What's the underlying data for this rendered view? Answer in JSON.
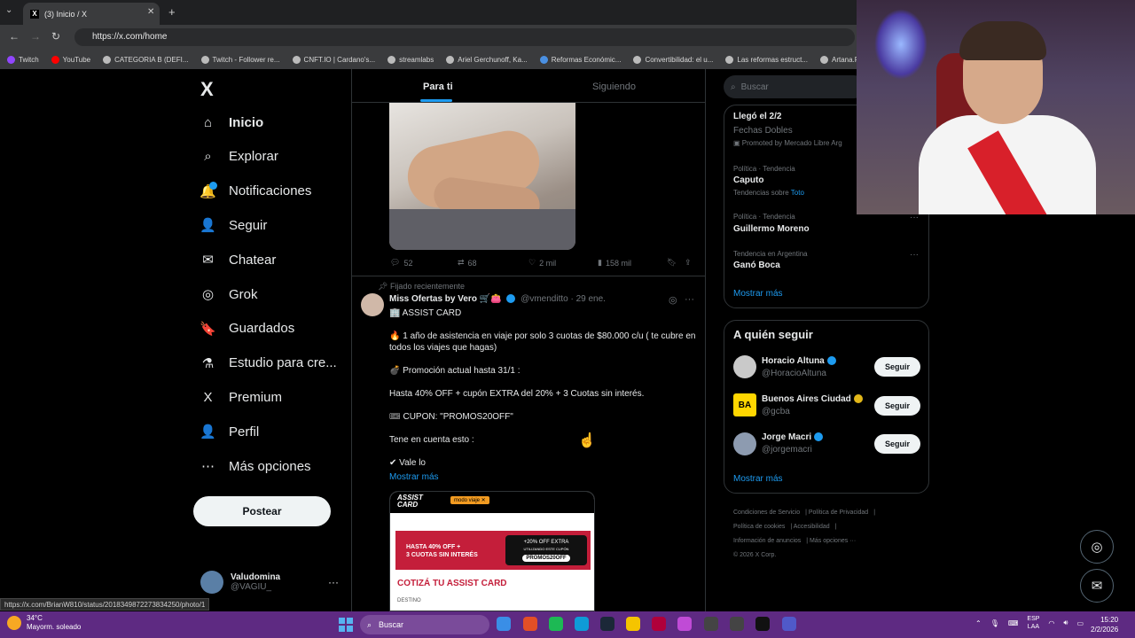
{
  "browser": {
    "tab_title": "(3) Inicio / X",
    "tab_close": "✕",
    "new_tab": "+",
    "tab_menu": "⌄",
    "url": "https://x.com/home",
    "bookmarks": [
      {
        "label": "Twitch",
        "color": "#9146ff"
      },
      {
        "label": "YouTube",
        "color": "#ff0000"
      },
      {
        "label": "CATEGORIA B (DEFI...",
        "color": "#bbbbbb"
      },
      {
        "label": "Twitch - Follower re...",
        "color": "#bbbbbb"
      },
      {
        "label": "CNFT.IO | Cardano's...",
        "color": "#bbbbbb"
      },
      {
        "label": "streamlabs",
        "color": "#bbbbbb"
      },
      {
        "label": "Ariel Gerchunoff, Ka...",
        "color": "#bbbbbb"
      },
      {
        "label": "Reformas Económic...",
        "color": "#4a90e2"
      },
      {
        "label": "Convertibilidad: el u...",
        "color": "#bbbbbb"
      },
      {
        "label": "Las reformas estruct...",
        "color": "#bbbbbb"
      },
      {
        "label": "Artana.PDF",
        "color": "#bbbbbb"
      }
    ]
  },
  "nav": {
    "logo": "X",
    "items": [
      {
        "label": "Inicio",
        "icon": "⌂"
      },
      {
        "label": "Explorar",
        "icon": "⌕"
      },
      {
        "label": "Notificaciones",
        "icon": "🔔"
      },
      {
        "label": "Seguir",
        "icon": "👤"
      },
      {
        "label": "Chatear",
        "icon": "✉"
      },
      {
        "label": "Grok",
        "icon": "◎"
      },
      {
        "label": "Guardados",
        "icon": "🔖"
      },
      {
        "label": "Estudio para cre...",
        "icon": "⚗"
      },
      {
        "label": "Premium",
        "icon": "X"
      },
      {
        "label": "Perfil",
        "icon": "👤"
      },
      {
        "label": "Más opciones",
        "icon": "⋯"
      }
    ],
    "post_label": "Postear",
    "account_name": "Valudomina",
    "account_handle": "@VAGIU_",
    "account_more": "···"
  },
  "feed": {
    "tab_for_you": "Para ti",
    "tab_following": "Siguiendo",
    "first_post_actions": {
      "replies": "52",
      "reposts": "68",
      "likes": "2 mil",
      "views": "158 mil"
    },
    "pinned_label": "Fijado recientemente",
    "tweet": {
      "name": "Miss Ofertas by Vero 🛒👛",
      "handle": "@vmenditto",
      "date": "· 29 ene.",
      "more": "···",
      "lines": [
        "🏢 ASSIST CARD",
        "🔥 1 año de asistencia en viaje por solo 3 cuotas de $80.000 c/u ( te cubre en todos los viajes que hagas)",
        "💣 Promoción actual hasta 31/1 :",
        "Hasta 40% OFF + cupón EXTRA del 20% + 3 Cuotas sin interés.",
        "🎟 CUPON: \"PROMOS20OFF\"",
        "Tene en cuenta esto :",
        "✔ Vale lo"
      ],
      "show_more": "Mostrar más"
    },
    "card": {
      "logo_line1": "ASSIST",
      "logo_line2": "CARD",
      "tag": "modo viaje ✕",
      "banner_line1": "HASTA 40% OFF +",
      "banner_line2": "3 CUOTAS SIN INTERÉS",
      "pill_line1": "+20% OFF EXTRA",
      "pill_line2": "UTILIZANDO ESTE CUPÓN",
      "pill_code": "PROMOS20OFF",
      "cta": "COTIZÁ TU ASSIST CARD",
      "dest": "DESTINO"
    }
  },
  "sidebar": {
    "search_placeholder": "Buscar",
    "trends": [
      {
        "meta": "",
        "title": "Llegó el 2/2",
        "sub": "Fechas Dobles",
        "extra": "Promoted by Mercado Libre Arg"
      },
      {
        "meta": "Política · Tendencia",
        "title": "Caputo",
        "sub": "Tendencias sobre",
        "extra": "Toto"
      },
      {
        "meta": "Política · Tendencia",
        "title": "Guillermo Moreno",
        "sub": "",
        "extra": ""
      },
      {
        "meta": "Tendencia en Argentina",
        "title": "Ganó Boca",
        "sub": "",
        "extra": ""
      }
    ],
    "trend_more": "···",
    "show_more": "Mostrar más",
    "who_to_follow_title": "A quién seguir",
    "follow": [
      {
        "name": "Horacio Altuna",
        "handle": "@HoracioAltuna",
        "button": "Seguir",
        "avatar_color": "#c9c9c9",
        "verified": "blue"
      },
      {
        "name": "Buenos Aires Ciudad",
        "handle": "@gcba",
        "button": "Seguir",
        "avatar_color": "#ffd600",
        "avatar_text": "BA",
        "verified": "gold"
      },
      {
        "name": "Jorge Macri",
        "handle": "@jorgemacri",
        "button": "Seguir",
        "avatar_color": "#8d9bb0",
        "verified": "blue"
      }
    ],
    "follow_show_more": "Mostrar más",
    "footer": [
      "Condiciones de Servicio",
      "Política de Privacidad",
      "Política de cookies",
      "Accesibilidad",
      "Información de anuncios",
      "Más opciones ···",
      "© 2026 X Corp."
    ]
  },
  "status_url": "https://x.com/BrianW810/status/2018349872273834250/photo/1",
  "taskbar": {
    "temperature": "34°C",
    "weather": "Mayorm. soleado",
    "search": "Buscar",
    "lang_line1": "ESP",
    "lang_line2": "LAA",
    "time": "15:20",
    "date": "2/2/2026"
  }
}
